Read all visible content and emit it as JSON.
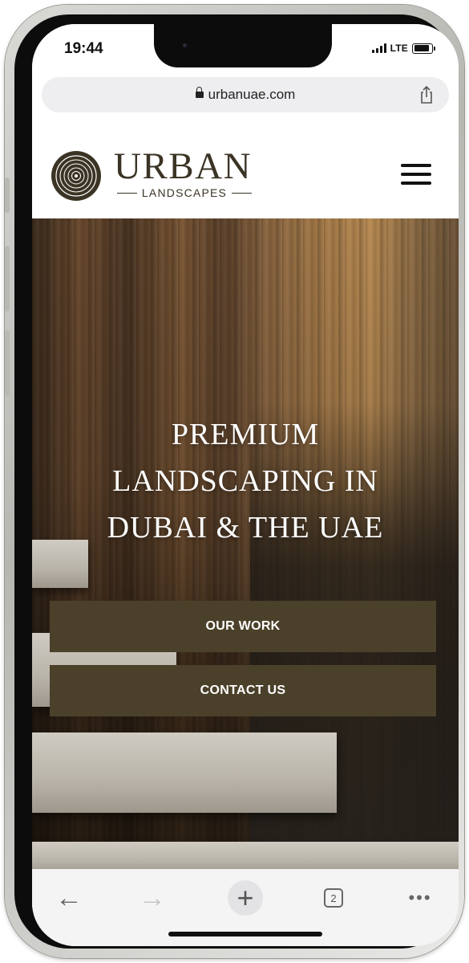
{
  "status": {
    "time": "19:44",
    "network": "LTE"
  },
  "browser": {
    "url": "urbanuae.com",
    "tab_count": "2"
  },
  "site": {
    "logo_name": "URBAN",
    "logo_sub": "LANDSCAPES",
    "brand_color": "#4b412a"
  },
  "hero": {
    "title_lines": [
      "PREMIUM",
      "LANDSCAPING IN",
      "DUBAI & THE UAE"
    ],
    "buttons": {
      "our_work": "OUR WORK",
      "contact_us": "CONTACT US"
    }
  },
  "toolbar": {
    "icons": [
      "back-arrow-icon",
      "forward-arrow-icon",
      "new-tab-plus-icon",
      "tabs-icon",
      "more-icon"
    ]
  }
}
